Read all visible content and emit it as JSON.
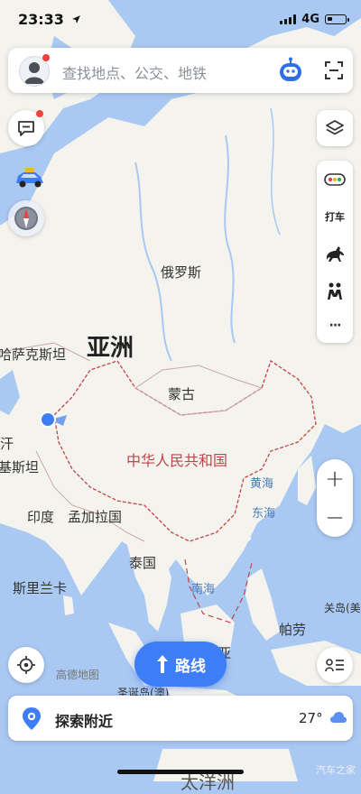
{
  "status_bar": {
    "time": "23:33",
    "network": "4G"
  },
  "search": {
    "placeholder": "查找地点、公交、地铁"
  },
  "map_labels": {
    "russia": "俄罗斯",
    "asia": "亚洲",
    "kazakhstan": "哈萨克斯坦",
    "mongolia": "蒙古",
    "china": "中华人民共和国",
    "yellow_sea": "黄海",
    "east_sea": "东海",
    "kyrgyz_fragment": "汗",
    "pakistan_fragment": "基斯坦",
    "india": "印度",
    "bangladesh": "孟加拉国",
    "thailand": "泰国",
    "south_sea": "南海",
    "sri_lanka": "斯里兰卡",
    "guam": "关岛(美",
    "palau": "帕劳",
    "map_vendor": "高德地图",
    "sangai": "圣诞岛(澳)",
    "asia_partial": "亚",
    "bottom_fragment": "太洋洲"
  },
  "toolbar": {
    "taxi_label": "打车",
    "more_label": "···"
  },
  "zoom": {
    "in_label": "+",
    "out_label": "−"
  },
  "route_button": {
    "label": "路线"
  },
  "nearby_bar": {
    "label": "探索附近",
    "temperature": "27°"
  },
  "watermark": "汽车之家",
  "icons": {
    "location": "navigation-arrow-icon",
    "avatar": "user-avatar-icon",
    "assistant": "robot-assistant-icon",
    "scan": "scan-icon",
    "message": "message-icon",
    "car": "car-icon",
    "compass": "compass-icon",
    "layers": "layers-icon",
    "traffic": "traffic-light-icon",
    "horse": "horse-icon",
    "walk": "people-icon",
    "locate": "locate-icon",
    "list": "list-icon",
    "nearby": "pin-icon",
    "weather": "cloud-icon"
  },
  "colors": {
    "accent": "#3d7df5",
    "sea": "#a9c8f2",
    "land": "#f4f3ee",
    "border": "#c0454a"
  }
}
